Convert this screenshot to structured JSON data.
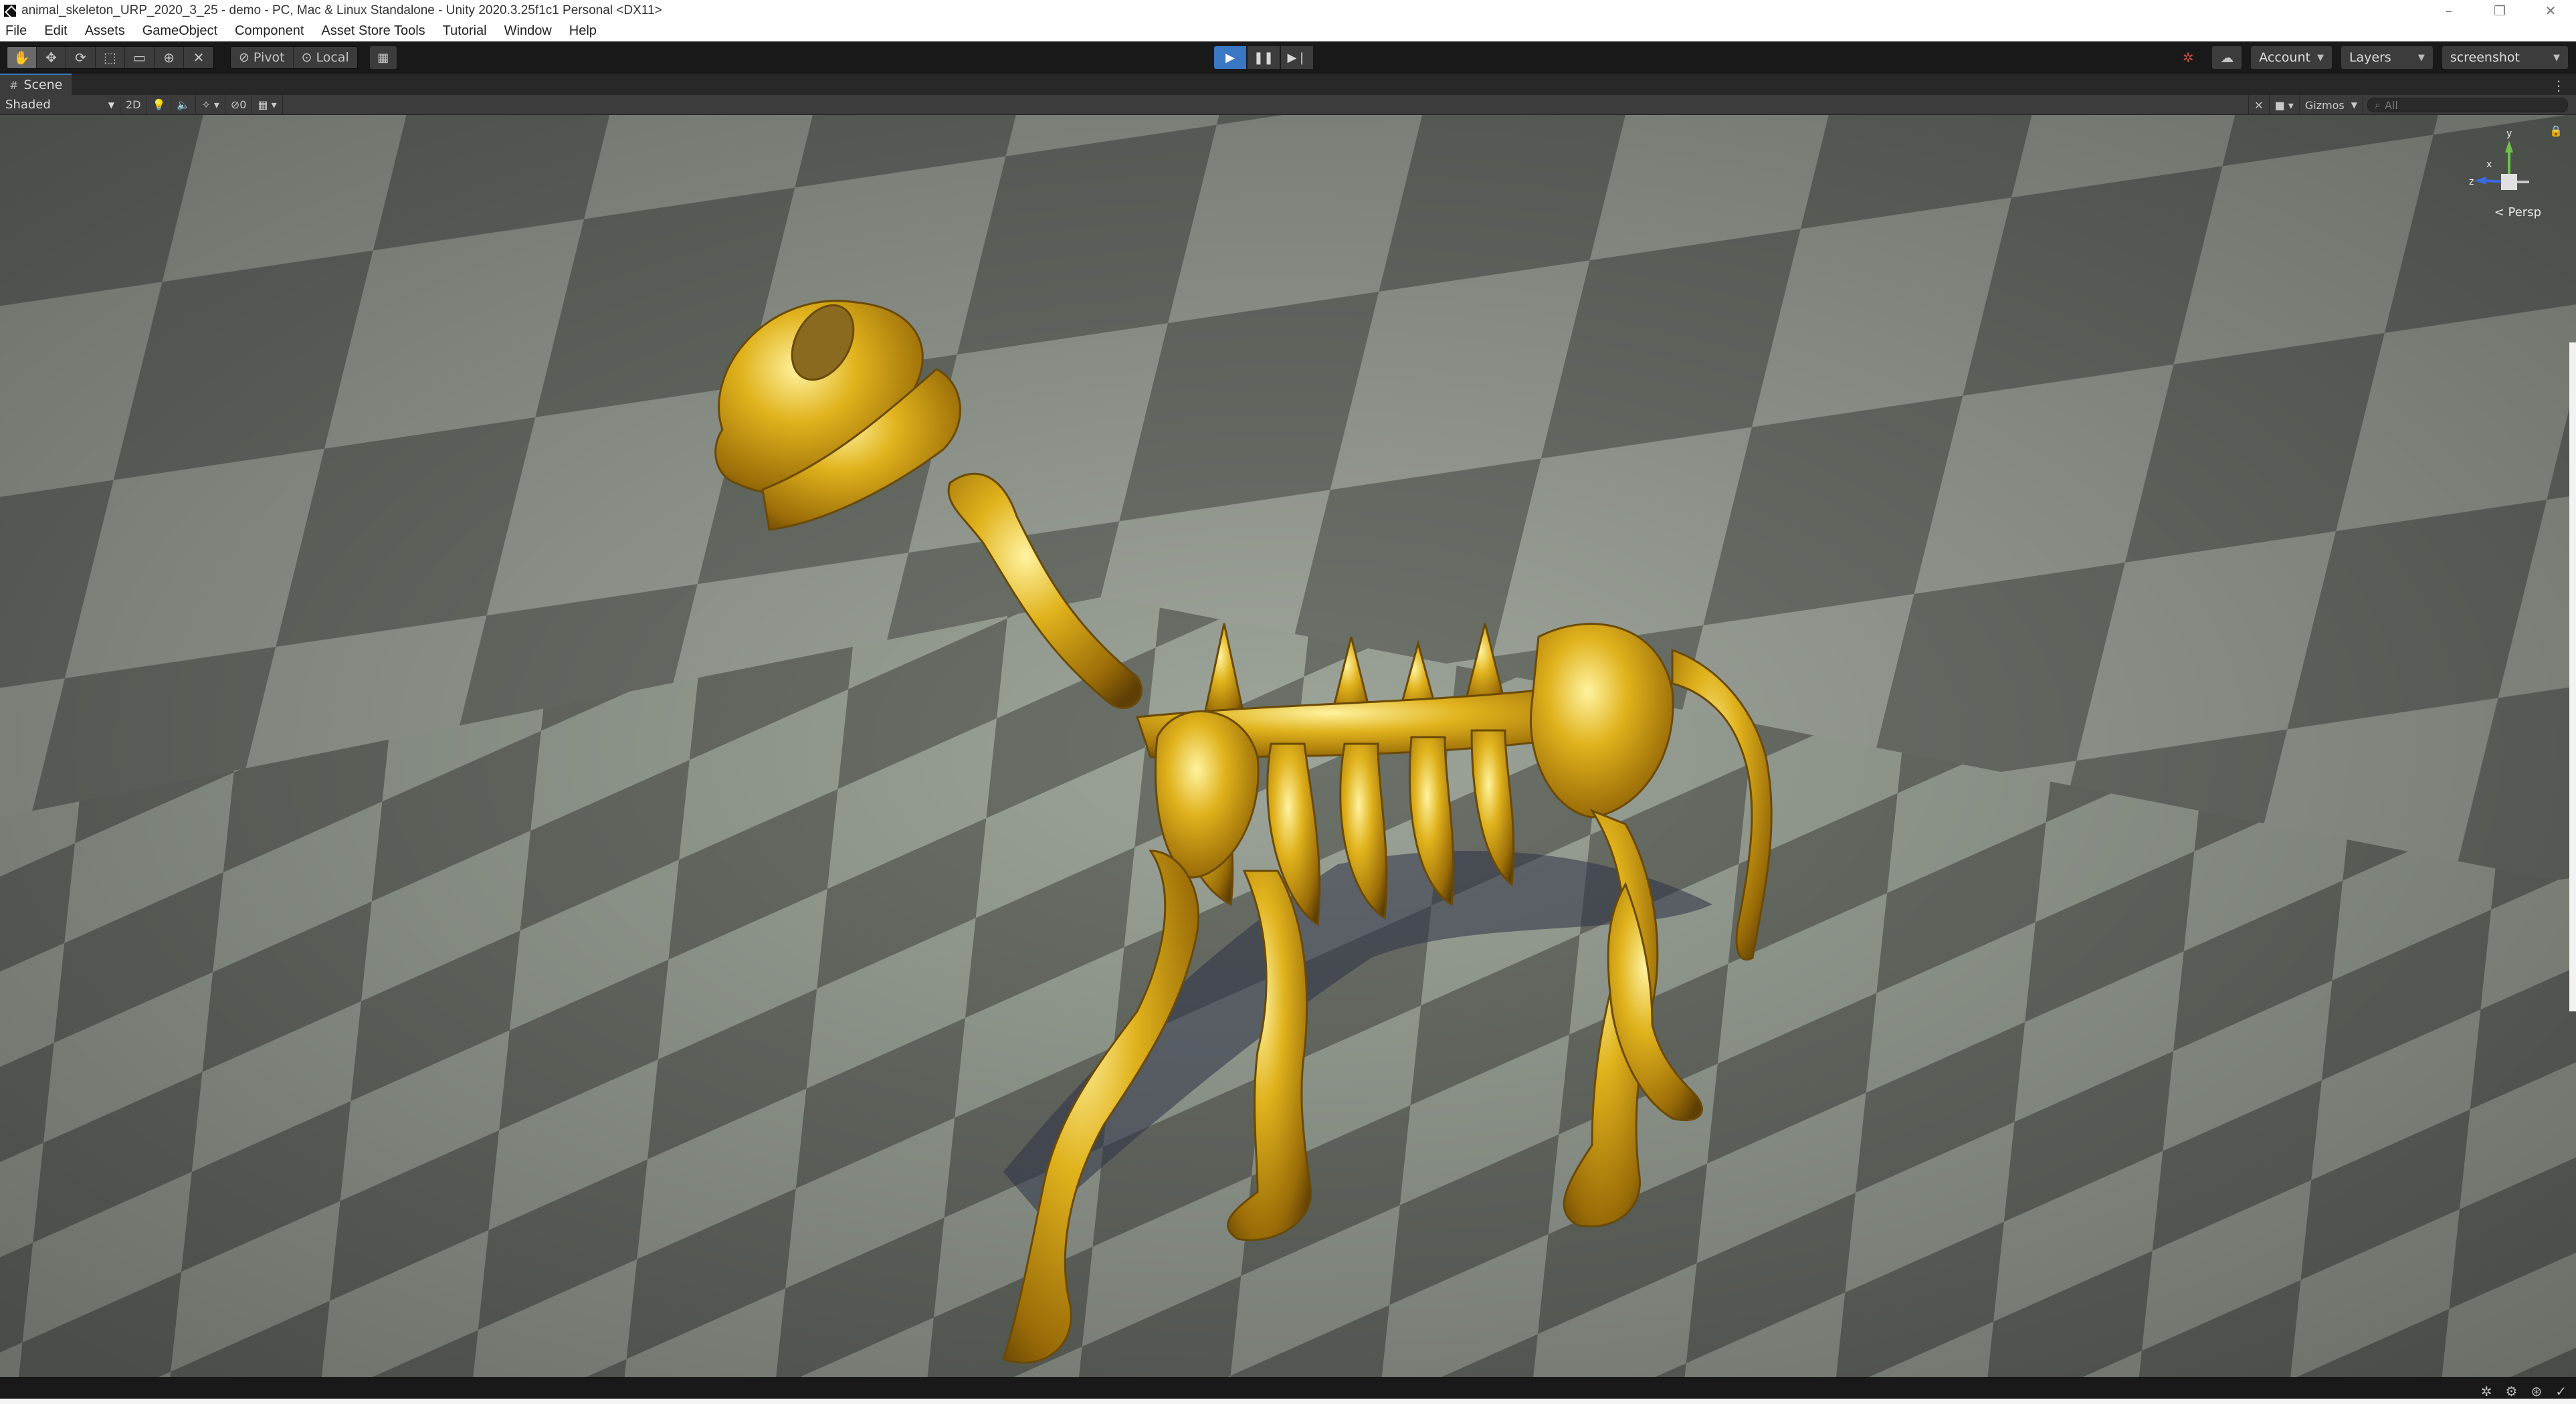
{
  "window": {
    "title": "animal_skeleton_URP_2020_3_25 - demo - PC, Mac & Linux Standalone - Unity 2020.3.25f1c1 Personal <DX11>",
    "controls": [
      "–",
      "❐",
      "✕"
    ]
  },
  "menu": [
    "File",
    "Edit",
    "Assets",
    "GameObject",
    "Component",
    "Asset Store Tools",
    "Tutorial",
    "Window",
    "Help"
  ],
  "toolbar": {
    "tools": [
      "hand-icon",
      "move-icon",
      "rotate-icon",
      "scale-icon",
      "rect-icon",
      "transform-icon",
      "custom-tool-icon"
    ],
    "pivot_label": "Pivot",
    "local_label": "Local",
    "account_label": "Account",
    "layers_label": "Layers",
    "layout_label": "screenshot"
  },
  "scene_tab": {
    "label": "Scene"
  },
  "scene_toolbar": {
    "shading": "Shaded",
    "mode_2d": "2D",
    "hidden_count": "0",
    "gizmos_label": "Gizmos",
    "search_placeholder": "All"
  },
  "viewport": {
    "projection_label": "< Persp",
    "gizmo_axes": {
      "y": "y",
      "x": "x",
      "z": "z"
    },
    "model_color": "#d4a418"
  }
}
